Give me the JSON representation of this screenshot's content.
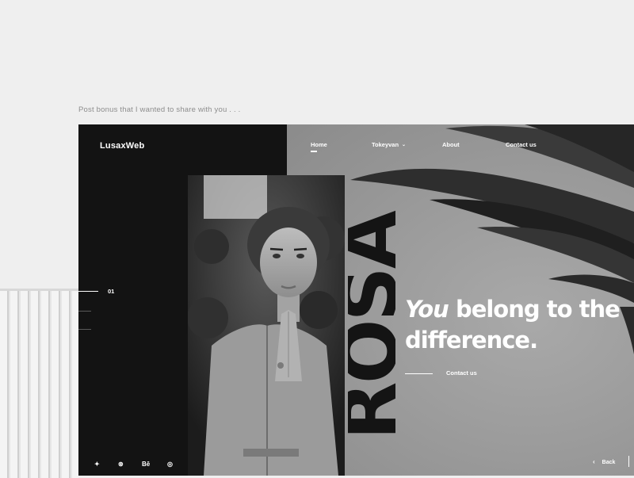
{
  "caption": "Post bonus that I wanted to share with you . . .",
  "site": {
    "logo": "LusaxWeb",
    "nav": [
      {
        "label": "Home"
      },
      {
        "label": "Tokeyvan"
      },
      {
        "label": "About"
      },
      {
        "label": "Contact us"
      }
    ],
    "slide_number": "01",
    "vertical_word": "ROSA",
    "headline": {
      "line1_italic": "You",
      "line1_rest": " belong to the",
      "line2": "difference."
    },
    "cta_label": "Contact us",
    "social": [
      {
        "icon": "twitter-icon",
        "glyph": "✦"
      },
      {
        "icon": "dribbble-icon",
        "glyph": "⊛"
      },
      {
        "icon": "behance-icon",
        "glyph": "Bē"
      },
      {
        "icon": "instagram-icon",
        "glyph": "◎"
      }
    ],
    "back_label": "Back",
    "back_arrow": "‹"
  },
  "colors": {
    "dark_panel": "#131313",
    "grey_panel": "#9c9c9c",
    "page_bg": "#efefef"
  }
}
